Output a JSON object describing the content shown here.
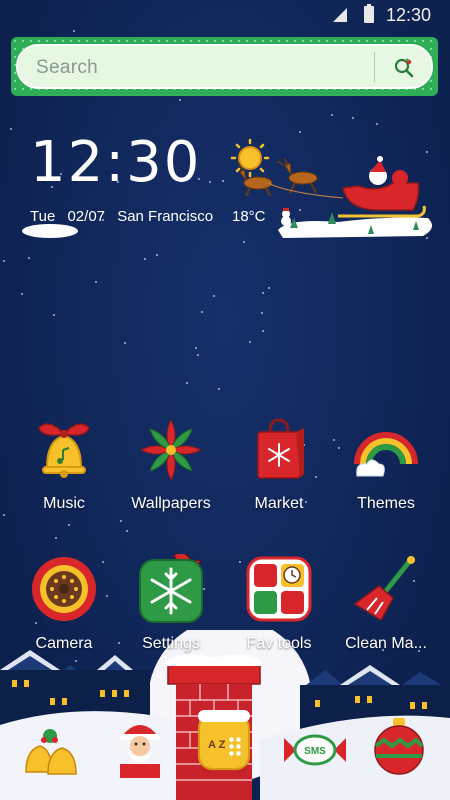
{
  "status_bar": {
    "time": "12:30"
  },
  "search": {
    "placeholder": "Search"
  },
  "clock_widget": {
    "time": "12:30",
    "day": "Tue",
    "date": "02/07",
    "city": "San Francisco",
    "temperature": "18°C"
  },
  "apps_row1": [
    {
      "label": "Music",
      "icon": "bell-icon"
    },
    {
      "label": "Wallpapers",
      "icon": "poinsettia-icon"
    },
    {
      "label": "Market",
      "icon": "shopping-bag-icon"
    },
    {
      "label": "Themes",
      "icon": "rainbow-icon"
    }
  ],
  "apps_row2": [
    {
      "label": "Camera",
      "icon": "lollipop-icon"
    },
    {
      "label": "Settings",
      "icon": "snowflake-icon"
    },
    {
      "label": "Fav tools",
      "icon": "tools-grid-icon"
    },
    {
      "label": "Clean Ma...",
      "icon": "broom-icon"
    }
  ],
  "dock": [
    {
      "icon": "jingle-bells-icon"
    },
    {
      "icon": "santa-icon"
    },
    {
      "icon": "app-drawer-icon",
      "label": "A Z"
    },
    {
      "icon": "sms-candy-icon",
      "label": "SMS"
    },
    {
      "icon": "ornament-icon"
    }
  ],
  "colors": {
    "background": "#10275a",
    "search_frame": "#2fae57",
    "search_box": "#e6f7e2",
    "accent_red": "#d8262b"
  }
}
